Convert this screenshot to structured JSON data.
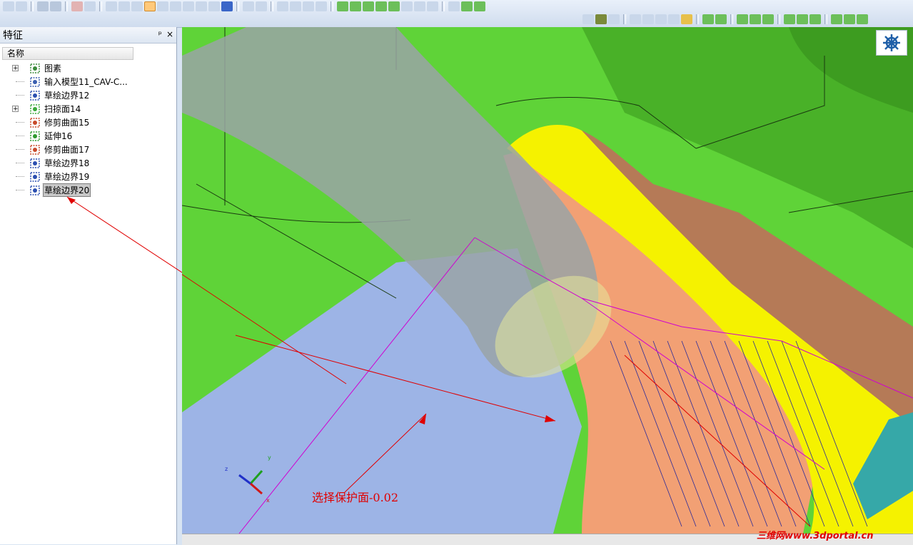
{
  "panel": {
    "title": "特征",
    "pin_glyph": "ᵖ",
    "close_glyph": "×",
    "column_header": "名称"
  },
  "tree": {
    "items": [
      {
        "label": "图素",
        "icon": "elements-icon",
        "expandable": true,
        "selected": false
      },
      {
        "label": "输入模型11_CAV-C...",
        "icon": "import-model-icon",
        "expandable": false,
        "selected": false
      },
      {
        "label": "草绘边界12",
        "icon": "sketch-boundary-icon",
        "expandable": false,
        "selected": false
      },
      {
        "label": "扫掠面14",
        "icon": "sweep-surface-icon",
        "expandable": true,
        "selected": false
      },
      {
        "label": "修剪曲面15",
        "icon": "trim-surface-icon",
        "expandable": false,
        "selected": false
      },
      {
        "label": "延伸16",
        "icon": "extend-icon",
        "expandable": false,
        "selected": false
      },
      {
        "label": "修剪曲面17",
        "icon": "trim-surface-icon",
        "expandable": false,
        "selected": false
      },
      {
        "label": "草绘边界18",
        "icon": "sketch-boundary-icon",
        "expandable": false,
        "selected": false
      },
      {
        "label": "草绘边界19",
        "icon": "sketch-boundary-icon",
        "expandable": false,
        "selected": false
      },
      {
        "label": "草绘边界20",
        "icon": "sketch-boundary-icon",
        "expandable": false,
        "selected": true
      }
    ]
  },
  "viewport": {
    "annotation": "选择保护面-0.02",
    "axis_labels": {
      "x": "x",
      "y": "y",
      "z": "z"
    },
    "nav_icon": "navigator-wheel-icon"
  },
  "watermark": "三维网www.3dportal.cn",
  "colors": {
    "model_green": "#5fd338",
    "protect_face": "#9db4e6",
    "salmon": "#f2a074",
    "brown": "#b57a57",
    "yellow": "#f5f200",
    "annotation_red": "#e00000",
    "tool_gray": "#9aa3a6"
  }
}
